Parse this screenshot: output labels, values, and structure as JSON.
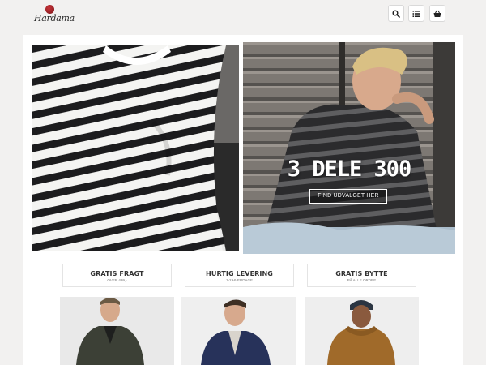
{
  "header": {
    "logo_text": "Hardama",
    "icons": [
      "search-icon",
      "list-icon",
      "basket-icon"
    ]
  },
  "hero": {
    "headline": "3 DELE 300",
    "cta_label": "FIND UDVALGET HER"
  },
  "usps": [
    {
      "title": "GRATIS FRAGT",
      "sub": "OVER 499,-"
    },
    {
      "title": "HURTIG LEVERING",
      "sub": "1-2 HVERDAGE"
    },
    {
      "title": "GRATIS BYTTE",
      "sub": "PÅ ALLE ORDRE"
    }
  ],
  "colors": {
    "page_background": "#f2f1f0",
    "panel_background": "#ffffff",
    "logo_accent": "#a3232a"
  }
}
